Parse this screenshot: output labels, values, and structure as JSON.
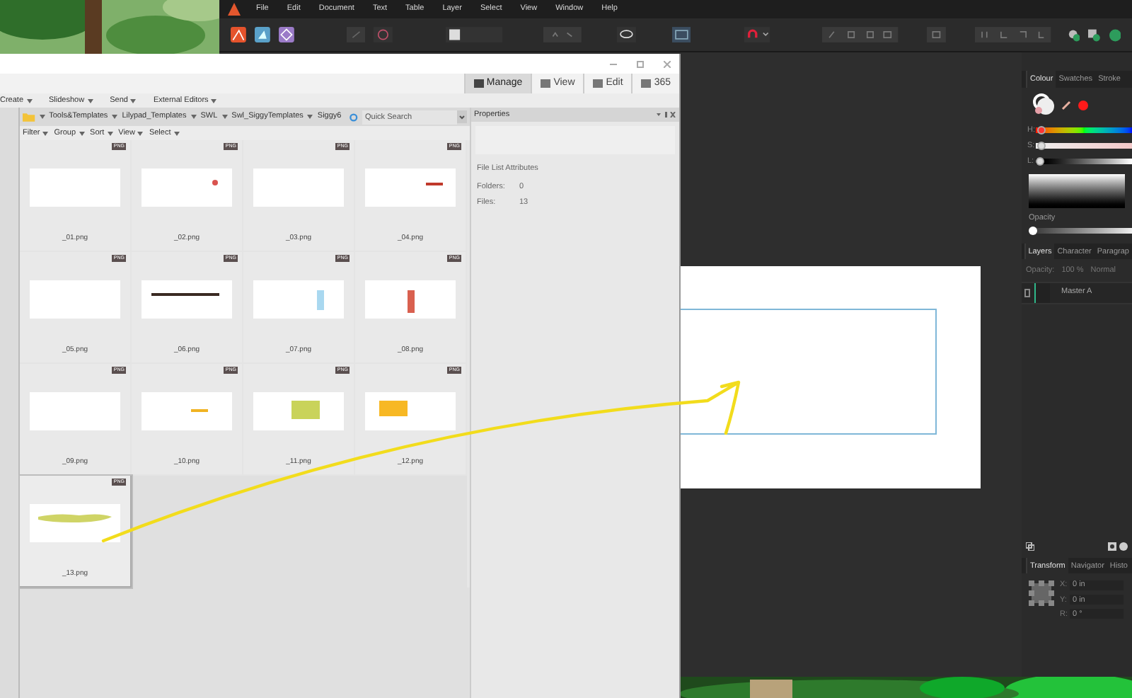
{
  "designer": {
    "menu": [
      "File",
      "Edit",
      "Document",
      "Text",
      "Table",
      "Layer",
      "Select",
      "View",
      "Window",
      "Help"
    ],
    "colour_panel": {
      "tabs": [
        {
          "label": "Colour",
          "selected": true
        },
        {
          "label": "Swatches",
          "selected": false
        },
        {
          "label": "Stroke",
          "selected": false
        }
      ],
      "sliders": [
        {
          "label": "H:",
          "level": 0.02
        },
        {
          "label": "S:",
          "level": 0.02
        },
        {
          "label": "L:",
          "level": 0
        }
      ],
      "opacity": {
        "label": "Opacity",
        "level": 0
      }
    },
    "layers_panel": {
      "tabs": [
        {
          "label": "Layers",
          "selected": true
        },
        {
          "label": "Character",
          "selected": false
        },
        {
          "label": "Paragrap",
          "selected": false
        }
      ],
      "opacity_label": "Opacity:",
      "opacity_value": "100 %",
      "blend_mode": "Normal",
      "layers": [
        {
          "name": "Master A"
        }
      ]
    },
    "transform_panel": {
      "tabs": [
        {
          "label": "Transform",
          "selected": true
        },
        {
          "label": "Navigator",
          "selected": false
        },
        {
          "label": "Histo",
          "selected": false
        }
      ],
      "fields": [
        {
          "label": "X:",
          "value": "0 in"
        },
        {
          "label": "Y:",
          "value": "0 in"
        },
        {
          "label": "R:",
          "value": "0 °"
        }
      ]
    }
  },
  "browser": {
    "modes": [
      {
        "label": "Manage",
        "selected": true
      },
      {
        "label": "View",
        "selected": false
      },
      {
        "label": "Edit",
        "selected": false
      },
      {
        "label": "365",
        "selected": false
      }
    ],
    "menu": [
      "Create",
      "Slideshow",
      "Send",
      "External Editors"
    ],
    "breadcrumb": [
      "Tools&Templates",
      "Lilypad_Templates",
      "SWL",
      "Swl_SiggyTemplates",
      "Siggy6"
    ],
    "search": {
      "placeholder": "Quick Search"
    },
    "filters": [
      "Filter",
      "Group",
      "Sort",
      "View",
      "Select"
    ],
    "files": [
      {
        "name": "_01.png",
        "badge": "PNG",
        "kind": "blank",
        "selected": false
      },
      {
        "name": "_02.png",
        "badge": "PNG",
        "kind": "dot",
        "color": "#d9534f",
        "selected": false
      },
      {
        "name": "_03.png",
        "badge": "PNG",
        "kind": "blank",
        "selected": false
      },
      {
        "name": "_04.png",
        "badge": "PNG",
        "kind": "dash",
        "color": "#c0392b",
        "selected": false
      },
      {
        "name": "_05.png",
        "badge": "PNG",
        "kind": "blank",
        "selected": false
      },
      {
        "name": "_06.png",
        "badge": "PNG",
        "kind": "line",
        "color": "#3a2a22",
        "selected": false
      },
      {
        "name": "_07.png",
        "badge": "PNG",
        "kind": "bar",
        "color": "#a9d8f0",
        "selected": false
      },
      {
        "name": "_08.png",
        "badge": "PNG",
        "kind": "bar",
        "color": "#d9604f",
        "selected": false
      },
      {
        "name": "_09.png",
        "badge": "PNG",
        "kind": "blank",
        "selected": false
      },
      {
        "name": "_10.png",
        "badge": "PNG",
        "kind": "dash",
        "color": "#f0b323",
        "selected": false
      },
      {
        "name": "_11.png",
        "badge": "PNG",
        "kind": "block",
        "color": "#c9d35a",
        "selected": false
      },
      {
        "name": "_12.png",
        "badge": "PNG",
        "kind": "block",
        "color": "#f7b824",
        "selected": false
      },
      {
        "name": "_13.png",
        "badge": "PNG",
        "kind": "smear",
        "color": "#cfd466",
        "selected": true
      }
    ],
    "properties": {
      "title": "Properties",
      "section": "File List Attributes",
      "rows": [
        {
          "label": "Folders:",
          "value": "0"
        },
        {
          "label": "Files:",
          "value": "13"
        }
      ]
    }
  }
}
